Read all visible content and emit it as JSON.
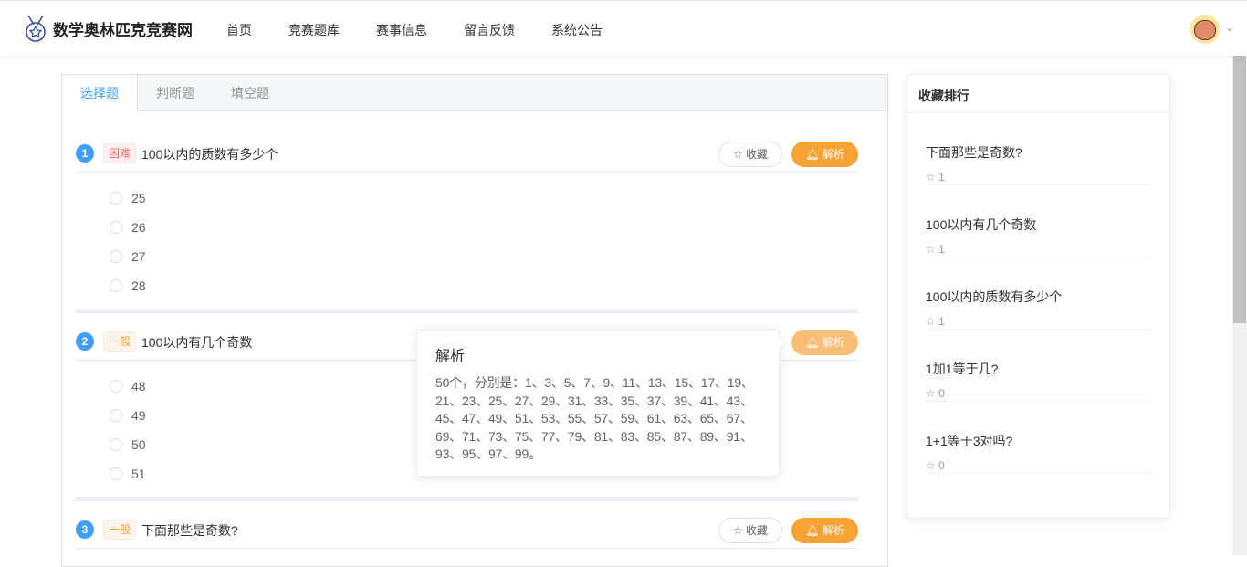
{
  "header": {
    "site_name": "数学奥林匹克竞赛网",
    "nav": [
      "首页",
      "竞赛题库",
      "赛事信息",
      "留言反馈",
      "系统公告"
    ]
  },
  "tabs": [
    "选择题",
    "判断题",
    "填空题"
  ],
  "buttons": {
    "favorite": "收藏",
    "analysis": "解析"
  },
  "questions": [
    {
      "num": "1",
      "level": "困难",
      "title": "100以内的质数有多少个",
      "options": [
        "25",
        "26",
        "27",
        "28"
      ]
    },
    {
      "num": "2",
      "level": "一般",
      "title": "100以内有几个奇数",
      "options": [
        "48",
        "49",
        "50",
        "51"
      ]
    },
    {
      "num": "3",
      "level": "一般",
      "title": "下面那些是奇数?",
      "options": []
    }
  ],
  "popover": {
    "title": "解析",
    "content": "50个，分别是：1、3、5、7、9、11、13、15、17、19、21、23、25、27、29、31、33、35、37、39、41、43、45、47、49、51、53、55、57、59、61、63、65、67、69、71、73、75、77、79、81、83、85、87、89、91、93、95、97、99。"
  },
  "sidebar": {
    "title": "收藏排行",
    "items": [
      {
        "title": "下面那些是奇数?",
        "count": "1"
      },
      {
        "title": "100以内有几个奇数",
        "count": "1"
      },
      {
        "title": "100以内的质数有多少个",
        "count": "1"
      },
      {
        "title": "1加1等于几?",
        "count": "0"
      },
      {
        "title": "1+1等于3对吗?",
        "count": "0"
      }
    ]
  },
  "colors": {
    "primary": "#409eff",
    "warning": "#f7a234",
    "danger": "#f56c6c"
  }
}
